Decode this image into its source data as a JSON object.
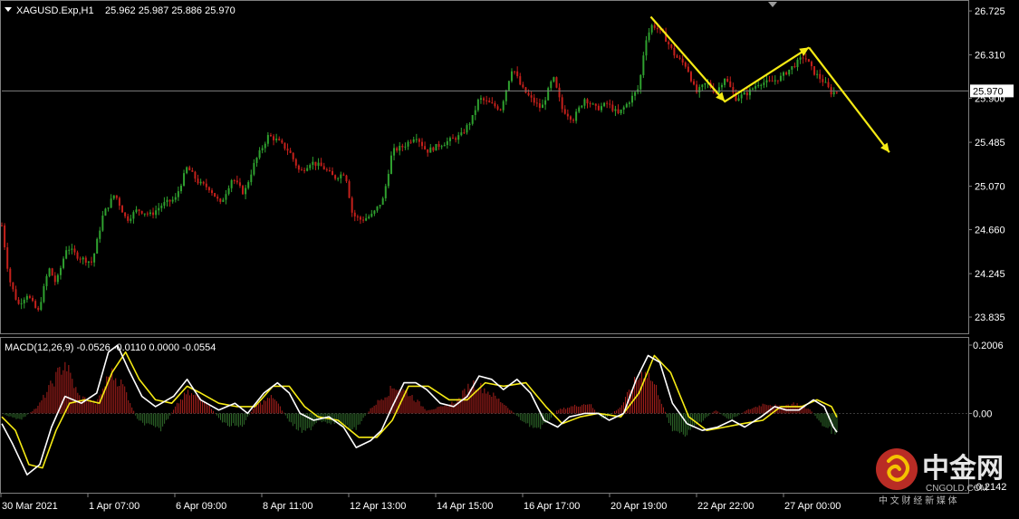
{
  "header": {
    "symbol": "XAGUSD.Exp,H1",
    "ohlc": "25.962 25.987 25.886 25.970",
    "macd_label": "MACD(12,26,9) -0.0526 -0.0110 0.0000 -0.0554"
  },
  "price_label": "25.970",
  "watermark": {
    "brand": "中金网",
    "site": "CNGOLD.COM",
    "tagline": "中 文 财 经 新 媒 体"
  },
  "colors": {
    "background": "#000000",
    "bull": "#2fa12f",
    "bear": "#c4201b",
    "hist_pos": "#a8201c",
    "hist_neg": "#2f6a2a",
    "macd_line": "#ffffff",
    "signal_line": "#f5ea14",
    "arrow": "#f5ea14",
    "grid": "#7f7f7f"
  },
  "chart_data": [
    {
      "type": "candlestick",
      "title": "",
      "x_ticks": [
        "30 Mar 2021",
        "1 Apr 07:00",
        "6 Apr 09:00",
        "8 Apr 11:00",
        "12 Apr 13:00",
        "14 Apr 15:00",
        "16 Apr 17:00",
        "20 Apr 19:00",
        "22 Apr 22:00",
        "27 Apr 00:00"
      ],
      "y_ticks": [
        26.725,
        26.31,
        25.9,
        25.485,
        25.07,
        24.66,
        24.245,
        23.835
      ],
      "ylim": [
        23.75,
        26.76
      ],
      "current_price": 25.97,
      "close_path": [
        [
          0,
          24.7
        ],
        [
          8,
          24.2
        ],
        [
          18,
          23.95
        ],
        [
          28,
          24.05
        ],
        [
          40,
          23.88
        ],
        [
          52,
          24.3
        ],
        [
          60,
          24.15
        ],
        [
          72,
          24.5
        ],
        [
          85,
          24.4
        ],
        [
          100,
          24.35
        ],
        [
          112,
          24.8
        ],
        [
          125,
          25.0
        ],
        [
          138,
          24.75
        ],
        [
          150,
          24.85
        ],
        [
          165,
          24.8
        ],
        [
          178,
          24.9
        ],
        [
          192,
          24.95
        ],
        [
          205,
          25.25
        ],
        [
          218,
          25.1
        ],
        [
          230,
          25.05
        ],
        [
          242,
          24.9
        ],
        [
          255,
          25.15
        ],
        [
          268,
          25.0
        ],
        [
          280,
          25.3
        ],
        [
          295,
          25.55
        ],
        [
          305,
          25.5
        ],
        [
          318,
          25.4
        ],
        [
          330,
          25.2
        ],
        [
          342,
          25.3
        ],
        [
          355,
          25.25
        ],
        [
          368,
          25.15
        ],
        [
          380,
          25.2
        ],
        [
          388,
          24.8
        ],
        [
          398,
          24.75
        ],
        [
          410,
          24.8
        ],
        [
          422,
          24.95
        ],
        [
          432,
          25.4
        ],
        [
          445,
          25.45
        ],
        [
          458,
          25.55
        ],
        [
          470,
          25.4
        ],
        [
          482,
          25.45
        ],
        [
          495,
          25.5
        ],
        [
          508,
          25.55
        ],
        [
          520,
          25.7
        ],
        [
          528,
          25.9
        ],
        [
          540,
          25.85
        ],
        [
          552,
          25.8
        ],
        [
          565,
          26.2
        ],
        [
          575,
          26.0
        ],
        [
          585,
          25.9
        ],
        [
          597,
          25.8
        ],
        [
          610,
          26.1
        ],
        [
          620,
          25.8
        ],
        [
          632,
          25.7
        ],
        [
          645,
          25.9
        ],
        [
          658,
          25.8
        ],
        [
          670,
          25.85
        ],
        [
          682,
          25.75
        ],
        [
          692,
          25.85
        ],
        [
          705,
          26.0
        ],
        [
          712,
          26.45
        ],
        [
          720,
          26.6
        ],
        [
          732,
          26.5
        ],
        [
          745,
          26.3
        ],
        [
          758,
          26.2
        ],
        [
          768,
          25.95
        ],
        [
          780,
          26.05
        ],
        [
          790,
          25.95
        ],
        [
          800,
          26.1
        ],
        [
          812,
          25.9
        ],
        [
          825,
          25.95
        ],
        [
          838,
          26.05
        ],
        [
          850,
          26.05
        ],
        [
          862,
          26.1
        ],
        [
          875,
          26.2
        ],
        [
          888,
          26.3
        ],
        [
          898,
          26.15
        ],
        [
          910,
          26.05
        ],
        [
          918,
          25.95
        ],
        [
          925,
          25.97
        ]
      ]
    },
    {
      "type": "macd",
      "title": "",
      "y_ticks": [
        0.2006,
        0.0,
        -0.2142
      ],
      "ylim": [
        -0.2142,
        0.2006
      ],
      "histogram_path": [
        [
          0,
          0.0
        ],
        [
          20,
          -0.02
        ],
        [
          40,
          0.02
        ],
        [
          70,
          0.15
        ],
        [
          85,
          0.05
        ],
        [
          105,
          0.03
        ],
        [
          120,
          0.12
        ],
        [
          135,
          0.08
        ],
        [
          150,
          -0.02
        ],
        [
          175,
          -0.05
        ],
        [
          195,
          0.03
        ],
        [
          205,
          0.06
        ],
        [
          225,
          0.04
        ],
        [
          245,
          -0.03
        ],
        [
          265,
          -0.04
        ],
        [
          280,
          0.02
        ],
        [
          300,
          0.05
        ],
        [
          320,
          -0.03
        ],
        [
          335,
          -0.06
        ],
        [
          350,
          -0.02
        ],
        [
          370,
          -0.03
        ],
        [
          390,
          -0.05
        ],
        [
          410,
          0.02
        ],
        [
          435,
          0.08
        ],
        [
          450,
          0.06
        ],
        [
          470,
          0.01
        ],
        [
          490,
          0.02
        ],
        [
          505,
          0.04
        ],
        [
          520,
          0.09
        ],
        [
          535,
          0.07
        ],
        [
          555,
          0.03
        ],
        [
          575,
          -0.02
        ],
        [
          595,
          -0.05
        ],
        [
          615,
          0.01
        ],
        [
          630,
          0.02
        ],
        [
          650,
          0.03
        ],
        [
          665,
          -0.02
        ],
        [
          685,
          0.02
        ],
        [
          700,
          0.09
        ],
        [
          712,
          0.13
        ],
        [
          725,
          0.07
        ],
        [
          740,
          -0.04
        ],
        [
          755,
          -0.07
        ],
        [
          770,
          -0.03
        ],
        [
          790,
          0.01
        ],
        [
          805,
          -0.02
        ],
        [
          825,
          0.01
        ],
        [
          845,
          0.03
        ],
        [
          860,
          0.02
        ],
        [
          878,
          0.03
        ],
        [
          895,
          0.01
        ],
        [
          910,
          -0.04
        ],
        [
          922,
          -0.055
        ]
      ],
      "macd_path": [
        [
          0,
          -0.03
        ],
        [
          12,
          -0.09
        ],
        [
          28,
          -0.18
        ],
        [
          42,
          -0.15
        ],
        [
          55,
          -0.04
        ],
        [
          70,
          0.05
        ],
        [
          88,
          0.03
        ],
        [
          105,
          0.06
        ],
        [
          118,
          0.18
        ],
        [
          128,
          0.2
        ],
        [
          140,
          0.13
        ],
        [
          155,
          0.05
        ],
        [
          170,
          0.02
        ],
        [
          190,
          0.05
        ],
        [
          205,
          0.1
        ],
        [
          220,
          0.04
        ],
        [
          240,
          0.01
        ],
        [
          258,
          0.03
        ],
        [
          272,
          0.0
        ],
        [
          290,
          0.06
        ],
        [
          305,
          0.09
        ],
        [
          318,
          0.06
        ],
        [
          330,
          0.0
        ],
        [
          345,
          -0.02
        ],
        [
          362,
          -0.01
        ],
        [
          378,
          -0.04
        ],
        [
          392,
          -0.1
        ],
        [
          408,
          -0.08
        ],
        [
          420,
          -0.05
        ],
        [
          432,
          0.02
        ],
        [
          445,
          0.09
        ],
        [
          458,
          0.09
        ],
        [
          470,
          0.07
        ],
        [
          485,
          0.03
        ],
        [
          500,
          0.02
        ],
        [
          515,
          0.05
        ],
        [
          528,
          0.11
        ],
        [
          542,
          0.1
        ],
        [
          555,
          0.07
        ],
        [
          570,
          0.1
        ],
        [
          585,
          0.06
        ],
        [
          600,
          -0.02
        ],
        [
          615,
          -0.04
        ],
        [
          628,
          -0.01
        ],
        [
          645,
          0.0
        ],
        [
          660,
          0.0
        ],
        [
          672,
          -0.02
        ],
        [
          688,
          0.0
        ],
        [
          702,
          0.1
        ],
        [
          715,
          0.17
        ],
        [
          728,
          0.15
        ],
        [
          742,
          0.03
        ],
        [
          758,
          -0.03
        ],
        [
          775,
          -0.05
        ],
        [
          792,
          -0.04
        ],
        [
          808,
          -0.02
        ],
        [
          822,
          -0.04
        ],
        [
          840,
          -0.01
        ],
        [
          855,
          0.02
        ],
        [
          868,
          0.01
        ],
        [
          882,
          0.01
        ],
        [
          898,
          0.04
        ],
        [
          910,
          0.02
        ],
        [
          920,
          -0.04
        ],
        [
          924,
          -0.055
        ]
      ],
      "signal_path": [
        [
          0,
          -0.01
        ],
        [
          15,
          -0.05
        ],
        [
          30,
          -0.15
        ],
        [
          45,
          -0.16
        ],
        [
          60,
          -0.05
        ],
        [
          75,
          0.03
        ],
        [
          92,
          0.04
        ],
        [
          108,
          0.03
        ],
        [
          122,
          0.12
        ],
        [
          137,
          0.18
        ],
        [
          152,
          0.1
        ],
        [
          170,
          0.04
        ],
        [
          188,
          0.03
        ],
        [
          205,
          0.08
        ],
        [
          220,
          0.06
        ],
        [
          240,
          0.03
        ],
        [
          260,
          0.02
        ],
        [
          280,
          0.02
        ],
        [
          300,
          0.08
        ],
        [
          318,
          0.08
        ],
        [
          335,
          0.02
        ],
        [
          350,
          -0.01
        ],
        [
          372,
          -0.02
        ],
        [
          395,
          -0.07
        ],
        [
          415,
          -0.07
        ],
        [
          432,
          -0.02
        ],
        [
          450,
          0.08
        ],
        [
          472,
          0.08
        ],
        [
          495,
          0.04
        ],
        [
          515,
          0.04
        ],
        [
          535,
          0.09
        ],
        [
          555,
          0.08
        ],
        [
          580,
          0.09
        ],
        [
          602,
          0.02
        ],
        [
          620,
          -0.03
        ],
        [
          640,
          -0.01
        ],
        [
          660,
          0.0
        ],
        [
          685,
          -0.01
        ],
        [
          705,
          0.06
        ],
        [
          722,
          0.17
        ],
        [
          740,
          0.12
        ],
        [
          760,
          -0.01
        ],
        [
          780,
          -0.05
        ],
        [
          800,
          -0.04
        ],
        [
          820,
          -0.03
        ],
        [
          842,
          -0.02
        ],
        [
          862,
          0.02
        ],
        [
          885,
          0.02
        ],
        [
          902,
          0.04
        ],
        [
          918,
          0.02
        ],
        [
          924,
          -0.011
        ]
      ]
    }
  ],
  "annotations": {
    "zigzag": [
      [
        718,
        26.67
      ],
      [
        800,
        25.87
      ],
      [
        893,
        26.38
      ]
    ],
    "arrow_end": [
      [
        893,
        26.38
      ],
      [
        982,
        25.39
      ]
    ]
  }
}
